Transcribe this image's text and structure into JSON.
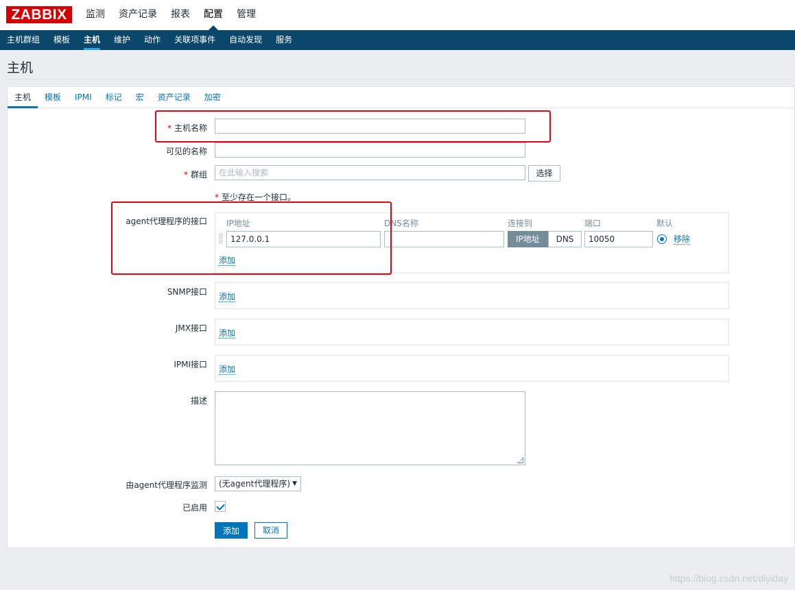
{
  "app": {
    "logo": "ZABBIX"
  },
  "topnav": [
    {
      "label": "监测",
      "active": false
    },
    {
      "label": "资产记录",
      "active": false
    },
    {
      "label": "报表",
      "active": false
    },
    {
      "label": "配置",
      "active": true
    },
    {
      "label": "管理",
      "active": false
    }
  ],
  "subnav": [
    {
      "label": "主机群组",
      "active": false
    },
    {
      "label": "模板",
      "active": false
    },
    {
      "label": "主机",
      "active": true
    },
    {
      "label": "维护",
      "active": false
    },
    {
      "label": "动作",
      "active": false
    },
    {
      "label": "关联项事件",
      "active": false
    },
    {
      "label": "自动发现",
      "active": false
    },
    {
      "label": "服务",
      "active": false
    }
  ],
  "page": {
    "title": "主机"
  },
  "tabs": [
    {
      "label": "主机",
      "active": true
    },
    {
      "label": "模板",
      "active": false
    },
    {
      "label": "IPMI",
      "active": false
    },
    {
      "label": "标记",
      "active": false
    },
    {
      "label": "宏",
      "active": false
    },
    {
      "label": "资产记录",
      "active": false
    },
    {
      "label": "加密",
      "active": false
    }
  ],
  "form": {
    "host_name": {
      "label": "主机名称",
      "required_mark": "*",
      "value": ""
    },
    "visible_name": {
      "label": "可见的名称",
      "value": ""
    },
    "groups": {
      "label": "群组",
      "required_mark": "*",
      "placeholder": "在此输入搜索",
      "select_label": "选择"
    },
    "interface_note": {
      "mark": "*",
      "text": "至少存在一个接口。"
    },
    "agent_interfaces": {
      "label": "agent代理程序的接口",
      "columns": {
        "ip": "IP地址",
        "dns": "DNS名称",
        "connect": "连接到",
        "port": "端口",
        "default": "默认"
      },
      "row": {
        "ip": "127.0.0.1",
        "dns": "",
        "connect_options": [
          "IP地址",
          "DNS"
        ],
        "connect_selected": "IP地址",
        "port": "10050",
        "remove_label": "移除"
      },
      "add_label": "添加"
    },
    "snmp_interfaces": {
      "label": "SNMP接口",
      "add_label": "添加"
    },
    "jmx_interfaces": {
      "label": "JMX接口",
      "add_label": "添加"
    },
    "ipmi_interfaces": {
      "label": "IPMI接口",
      "add_label": "添加"
    },
    "description": {
      "label": "描述",
      "value": ""
    },
    "monitored_by_proxy": {
      "label": "由agent代理程序监测",
      "value": "(无agent代理程序)"
    },
    "enabled": {
      "label": "已启用",
      "checked": true
    },
    "buttons": {
      "add": "添加",
      "cancel": "取消"
    }
  },
  "watermark": "https://blog.csdn.net/diyiday",
  "colors": {
    "brand": "#d40000",
    "subnav_bg": "#0a466a",
    "link": "#0275b8",
    "annotation": "#e60012"
  }
}
